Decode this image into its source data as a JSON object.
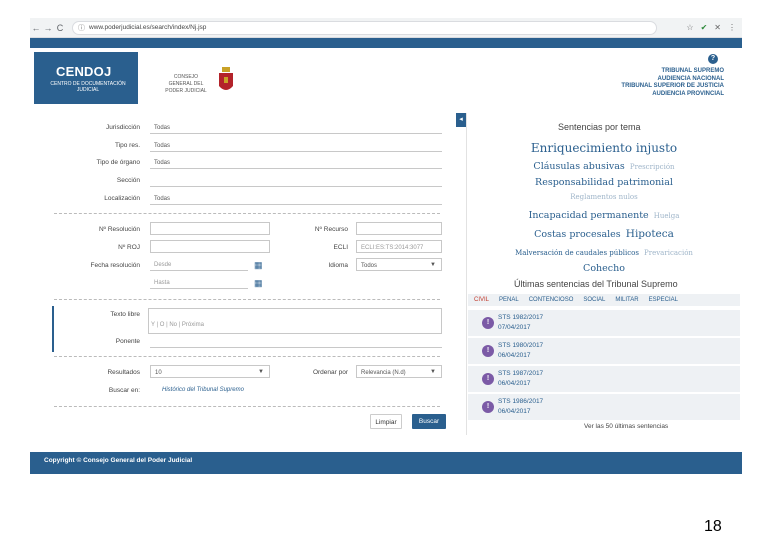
{
  "browser": {
    "url": "www.poderjudicial.es/search/index/Nj.jsp",
    "back": "←",
    "forward": "→",
    "reload": "C",
    "info_icon": "ⓘ",
    "icons": [
      "☆",
      "✔",
      "✕",
      "⋮"
    ]
  },
  "header": {
    "logo_title": "CENDOJ",
    "logo_subtitle": "CENTRO DE DOCUMENTACIÓN JUDICIAL",
    "cgpj_line1": "CONSEJO",
    "cgpj_line2": "GENERAL DEL",
    "cgpj_line3": "PODER JUDICIAL",
    "help": "?",
    "courts": [
      "TRIBUNAL SUPREMO",
      "AUDIENCIA NACIONAL",
      "TRIBUNAL SUPERIOR DE JUSTICIA",
      "AUDIENCIA PROVINCIAL"
    ]
  },
  "form": {
    "jurisdiccion_label": "Jurisdicción",
    "jurisdiccion_value": "Todas",
    "tipo_res_label": "Tipo res.",
    "tipo_res_value": "Todas",
    "tipo_organo_label": "Tipo de órgano",
    "tipo_organo_value": "Todas",
    "seccion_label": "Sección",
    "localizacion_label": "Localización",
    "localizacion_value": "Todas",
    "n_resolucion_label": "Nº Resolución",
    "n_recurso_label": "Nº Recurso",
    "n_roj_label": "Nº ROJ",
    "ecli_label": "ECLI",
    "ecli_value": "ECLI:ES:TS:2014:3077",
    "fecha_label": "Fecha resolución",
    "desde_ph": "Desde",
    "hasta_ph": "Hasta",
    "idioma_label": "Idioma",
    "idioma_value": "Todos",
    "texto_libre_label": "Texto libre",
    "texto_libre_hint": "Y | O | No | Próxima",
    "ponente_label": "Ponente",
    "resultados_label": "Resultados",
    "resultados_value": "10",
    "ordenar_label": "Ordenar por",
    "ordenar_value": "Relevancia (N.d)",
    "buscar_en_label": "Buscar en:",
    "historico_link": "Histórico del Tribunal Supremo",
    "limpiar": "Limpiar",
    "buscar": "Buscar",
    "collapse": "◂"
  },
  "cloud": {
    "title": "Sentencias por tema",
    "t1": "Enriquecimiento injusto",
    "t2": "Cláusulas abusivas",
    "t2b": "Prescripción",
    "t3": "Responsabilidad patrimonial",
    "t4": "Reglamentos nulos",
    "t5": "Incapacidad permanente",
    "t5b": "Huelga",
    "t6": "Costas procesales",
    "t6b": "Hipoteca",
    "t7": "Malversación de caudales públicos",
    "t7b": "Prevaricación",
    "t8": "Cohecho"
  },
  "latest": {
    "title": "Últimas sentencias del Tribunal Supremo",
    "tabs": [
      "CIVIL",
      "PENAL",
      "CONTENCIOSO",
      "SOCIAL",
      "MILITAR",
      "ESPECIAL"
    ],
    "items": [
      {
        "num": "STS 1982/2017",
        "date": "07/04/2017"
      },
      {
        "num": "STS 1980/2017",
        "date": "06/04/2017"
      },
      {
        "num": "STS 1987/2017",
        "date": "06/04/2017"
      },
      {
        "num": "STS 1986/2017",
        "date": "06/04/2017"
      }
    ],
    "badge": "!",
    "ver_mas": "Ver las 50 últimas sentencias"
  },
  "footer": {
    "copyright": "Copyright © Consejo General del Poder Judicial"
  },
  "page_number": "18"
}
